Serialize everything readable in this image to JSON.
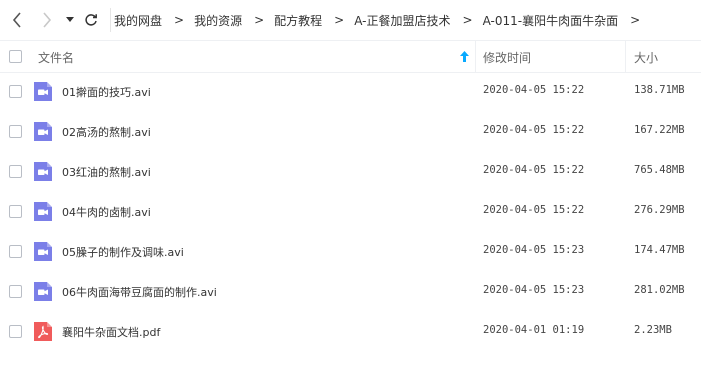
{
  "toolbar": {
    "breadcrumbs": [
      "我的网盘",
      "我的资源",
      "配方教程",
      "A-正餐加盟店技术",
      "A-011-襄阳牛肉面牛杂面"
    ],
    "separator": ">"
  },
  "header": {
    "name_label": "文件名",
    "modified_label": "修改时间",
    "size_label": "大小",
    "sort_icon": "sort-up-arrow",
    "accent": "#09aaff"
  },
  "files": [
    {
      "name": "01擀面的技巧.avi",
      "modified": "2020-04-05 15:22",
      "size": "138.71MB",
      "type": "video"
    },
    {
      "name": "02高汤的熬制.avi",
      "modified": "2020-04-05 15:22",
      "size": "167.22MB",
      "type": "video"
    },
    {
      "name": "03红油的熬制.avi",
      "modified": "2020-04-05 15:22",
      "size": "765.48MB",
      "type": "video"
    },
    {
      "name": "04牛肉的卤制.avi",
      "modified": "2020-04-05 15:22",
      "size": "276.29MB",
      "type": "video"
    },
    {
      "name": "05臊子的制作及调味.avi",
      "modified": "2020-04-05 15:23",
      "size": "174.47MB",
      "type": "video"
    },
    {
      "name": "06牛肉面海带豆腐面的制作.avi",
      "modified": "2020-04-05 15:23",
      "size": "281.02MB",
      "type": "video"
    },
    {
      "name": "襄阳牛杂面文档.pdf",
      "modified": "2020-04-01 01:19",
      "size": "2.23MB",
      "type": "pdf"
    }
  ],
  "colors": {
    "video_icon": "#7b7fe8",
    "pdf_icon": "#f05b5b"
  }
}
